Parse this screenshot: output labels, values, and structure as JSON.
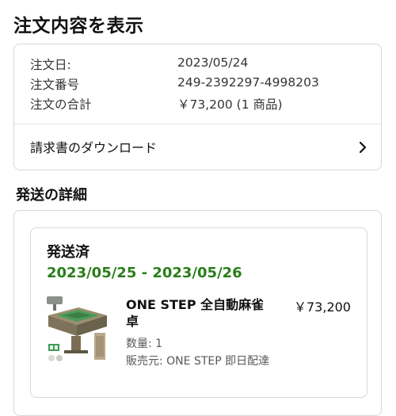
{
  "page": {
    "title": "注文内容を表示"
  },
  "summary": {
    "order_date_label": "注文日:",
    "order_date_value": "2023/05/24",
    "order_number_label": "注文番号",
    "order_number_value": "249-2392297-4998203",
    "total_label": "注文の合計",
    "total_value": "￥73,200 (1 商品)",
    "invoice_label": "請求書のダウンロード"
  },
  "shipping": {
    "section_title": "発送の詳細",
    "status": "発送済",
    "delivery_dates": "2023/05/25 - 2023/05/26",
    "item": {
      "name": "ONE STEP 全自動麻雀卓",
      "price": "￥73,200",
      "quantity": "数量: 1",
      "seller": "販売元: ONE STEP 即日配達"
    }
  },
  "colors": {
    "delivery_green": "#2a7e19",
    "border": "#d5d9d9",
    "secondary_text": "#565959"
  },
  "icons": {
    "invoice_chevron": "chevron-right-icon",
    "product": "mahjong-table-image"
  }
}
